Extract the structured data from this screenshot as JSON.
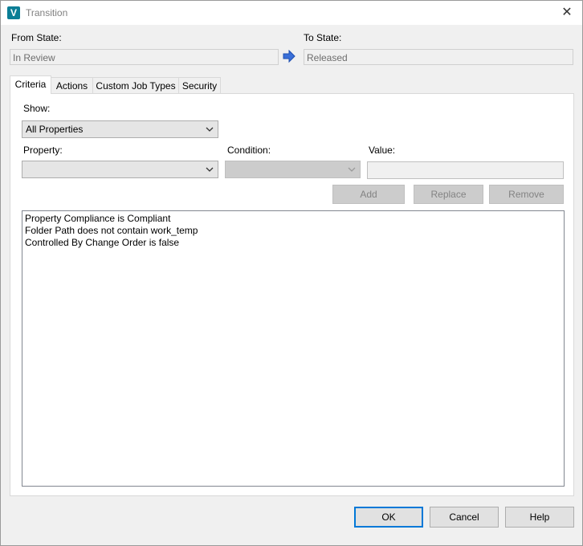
{
  "window": {
    "title": "Transition",
    "app_icon": "V"
  },
  "states": {
    "from_label": "From State:",
    "from_value": "In Review",
    "to_label": "To State:",
    "to_value": "Released"
  },
  "tabs": [
    {
      "label": "Criteria",
      "active": true
    },
    {
      "label": "Actions"
    },
    {
      "label": "Custom Job Types"
    },
    {
      "label": "Security"
    }
  ],
  "criteria": {
    "show_label": "Show:",
    "show_value": "All Properties",
    "property_label": "Property:",
    "property_value": "",
    "condition_label": "Condition:",
    "condition_value": "",
    "value_label": "Value:",
    "value_value": "",
    "add_label": "Add",
    "replace_label": "Replace",
    "remove_label": "Remove",
    "items": [
      "Property Compliance is Compliant",
      "Folder Path does not contain work_temp",
      "Controlled By Change Order is false"
    ]
  },
  "buttons": {
    "ok": "OK",
    "cancel": "Cancel",
    "help": "Help"
  },
  "colors": {
    "accent": "#0078d7",
    "arrow": "#3a6fd8",
    "app_icon": "#0a7e96"
  }
}
